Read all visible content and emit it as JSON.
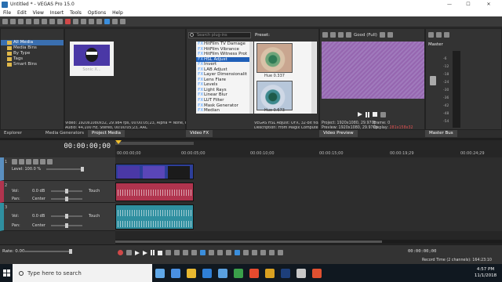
{
  "window": {
    "title": "Untitled * - VEGAS Pro 15.0",
    "minimize": "—",
    "maximize": "☐",
    "close": "✕"
  },
  "menu": [
    "File",
    "Edit",
    "View",
    "Insert",
    "Tools",
    "Options",
    "Help"
  ],
  "explorer": {
    "tree": [
      "All Media",
      "Media Bins",
      "By Type",
      "Tags",
      "Smart Bins"
    ],
    "tabs": [
      "Explorer",
      "Media Generators",
      "Project Media"
    ],
    "media_name": "Sonic X...",
    "info_line1": "Video: 1920x1080x32, 29.984 fps, 00:00:05;23, Alpha = None, Fie",
    "info_line2": "Audio: 44,100 Hz, Stereo, 00:00:05;23, AAC"
  },
  "video_fx": {
    "search_placeholder": "Search plug-ins",
    "items": [
      "HitFilm TV Damage",
      "HitFilm Vibrance",
      "HitFilm Witness Prot",
      "HSL Adjust",
      "Invert",
      "LAB Adjust",
      "Layer Dimensionalit",
      "Lens Flare",
      "Levels",
      "Light Rays",
      "Linear Blur",
      "LUT Filter",
      "Mask Generator",
      "Median"
    ],
    "selected_index": 3,
    "fx_prefix": "FX",
    "preset_label": "Preset:",
    "preset_caption_1": "Hue 0.337",
    "preset_caption_2": "Hue 0.673",
    "description_1": "VEGAS HSL Adjust: OFX, 32-bit floa",
    "description_2": "Description: From Magix Computer P",
    "tab": "Video FX"
  },
  "preview": {
    "quality": "Good (Full)",
    "project": "Project:  1920x1080, 29.970p",
    "frame": "Frame:    0",
    "preview_res": "Preview:  1920x1080, 29.970p",
    "display": "Display:",
    "display_value": "281x158x32",
    "tab": "Video Preview",
    "frame_color": "#9a6fb0"
  },
  "master_bus": {
    "label": "Master",
    "tab": "Master Bus",
    "ticks": [
      "-6",
      "-12",
      "-18",
      "-24",
      "-30",
      "-36",
      "-42",
      "-48",
      "-54"
    ]
  },
  "timeline": {
    "timecode": "00:00:00;00",
    "ruler": [
      "00:00:00;00",
      "00:00:05;00",
      "00:00:10;00",
      "00:00:15;00",
      "00:00:19;29",
      "00:00:24;29"
    ],
    "video_track": {
      "number": "1",
      "level": "Level: 100.0 %"
    },
    "audio_tracks": [
      {
        "number": "2",
        "vol_label": "Vol:",
        "vol": "0.0 dB",
        "pan_label": "Pan:",
        "pan": "Center",
        "mode": "Touch"
      },
      {
        "number": "3",
        "vol_label": "Vol:",
        "vol": "0.0 dB",
        "pan_label": "Pan:",
        "pan": "Center",
        "mode": "Touch"
      }
    ],
    "rate": "Rate: 0.00",
    "transport_timecode": "00:00:00;00",
    "record_time": "Record Time (2 channels): 164:23:10"
  },
  "taskbar": {
    "search": "Type here to search",
    "time": "4:57 PM",
    "date": "11/1/2018"
  },
  "colors": {
    "accent": "#3b8edc",
    "audio_track_1": "#b0344e",
    "audio_track_2": "#2f8fa0",
    "video_clip": "#2d3f9a"
  }
}
